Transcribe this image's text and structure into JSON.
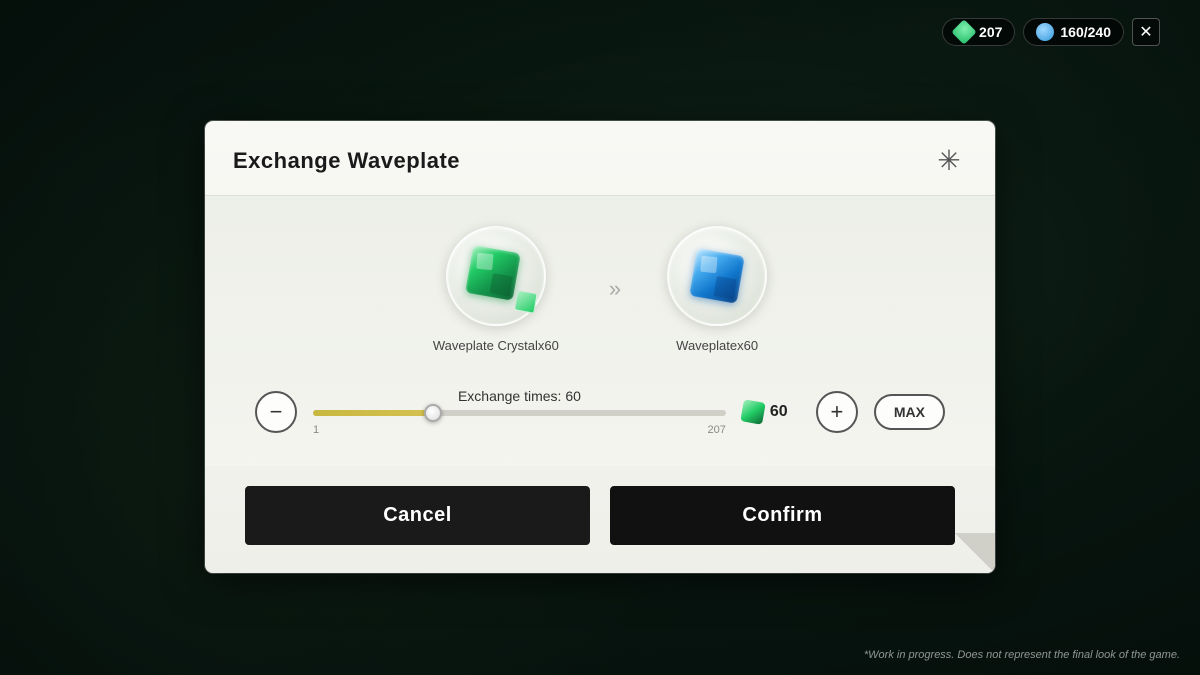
{
  "title": "Exchange Waveplate",
  "hud": {
    "currency1_value": "207",
    "currency2_value": "160/240"
  },
  "exchange": {
    "from_label": "Waveplate Crystalx60",
    "to_label": "Waveplatex60",
    "arrow": "»"
  },
  "slider": {
    "label": "Exchange times: 60",
    "value": 60,
    "min": 1,
    "max": 207,
    "fill_percent": 29,
    "crystal_count": "60",
    "max_label": "207"
  },
  "buttons": {
    "decrement_label": "−",
    "increment_label": "+",
    "max_label": "MAX",
    "cancel_label": "Cancel",
    "confirm_label": "Confirm"
  },
  "watermark": "*Work in progress. Does not represent the final look of the game."
}
